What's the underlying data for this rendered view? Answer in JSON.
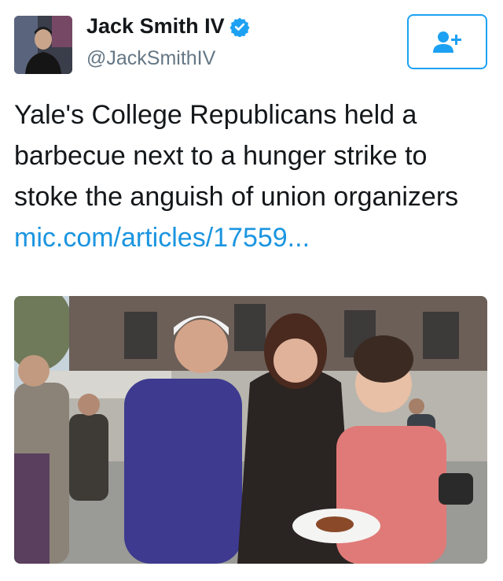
{
  "author": {
    "display_name": "Jack Smith IV",
    "handle": "@JackSmithIV",
    "verified": true,
    "avatar_icon": "profile-photo"
  },
  "follow_button": {
    "icon": "add-user-icon",
    "color": "#1da1f2"
  },
  "tweet": {
    "text": "Yale's College Republicans held a barbecue next to a hunger strike to stoke the anguish of union organizers",
    "link": "mic.com/articles/17559..."
  },
  "colors": {
    "accent": "#1da1f2",
    "link": "#1b95e0",
    "text": "#14171a",
    "secondary": "#657786"
  }
}
